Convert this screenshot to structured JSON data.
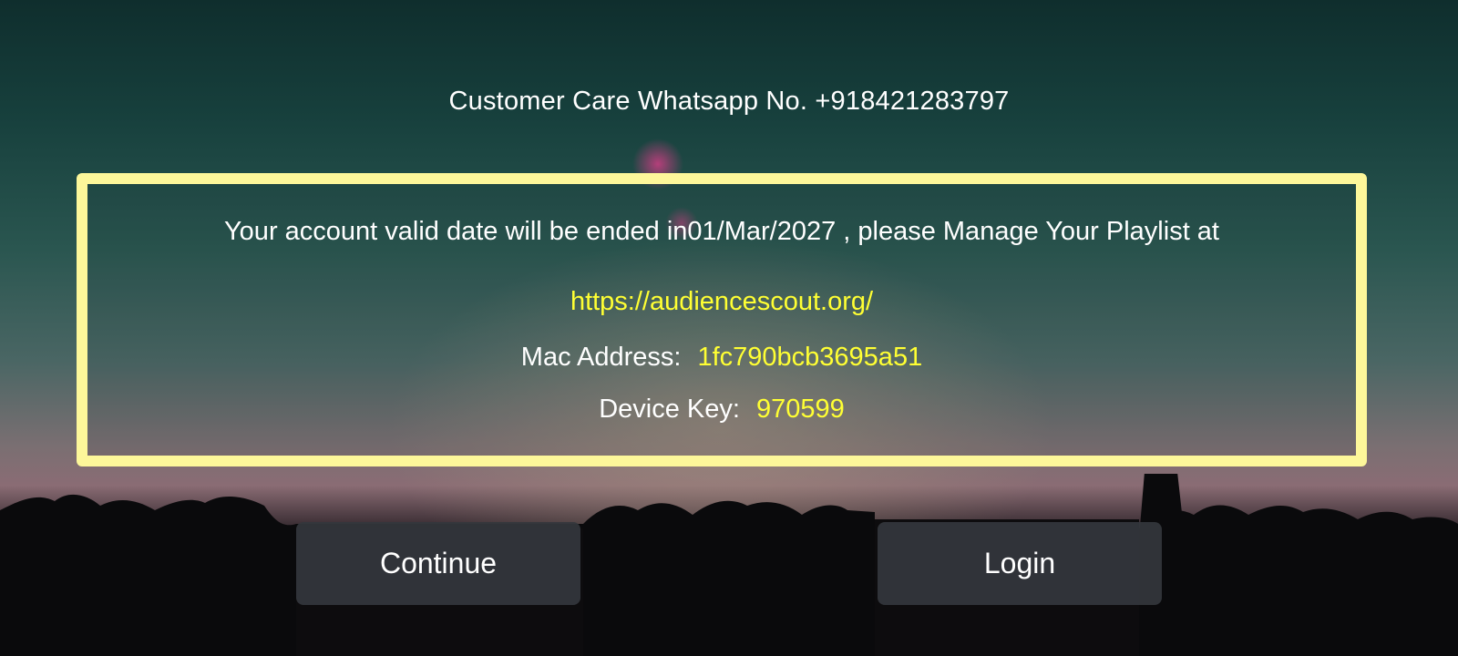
{
  "support": {
    "whatsapp_text": "Customer Care Whatsapp No. +918421283797"
  },
  "account": {
    "validity_message": "Your account valid date will be ended in01/Mar/2027 , please Manage Your Playlist at",
    "url": "https://audiencescout.org/",
    "mac_label": "Mac Address:",
    "mac_value": "1fc790bcb3695a51",
    "device_key_label": "Device Key:",
    "device_key_value": "970599"
  },
  "buttons": {
    "continue_label": "Continue",
    "login_label": "Login"
  },
  "colors": {
    "panel_border": "#fdf79a",
    "highlight_text": "#ffff33",
    "button_bg": "#34373c"
  }
}
